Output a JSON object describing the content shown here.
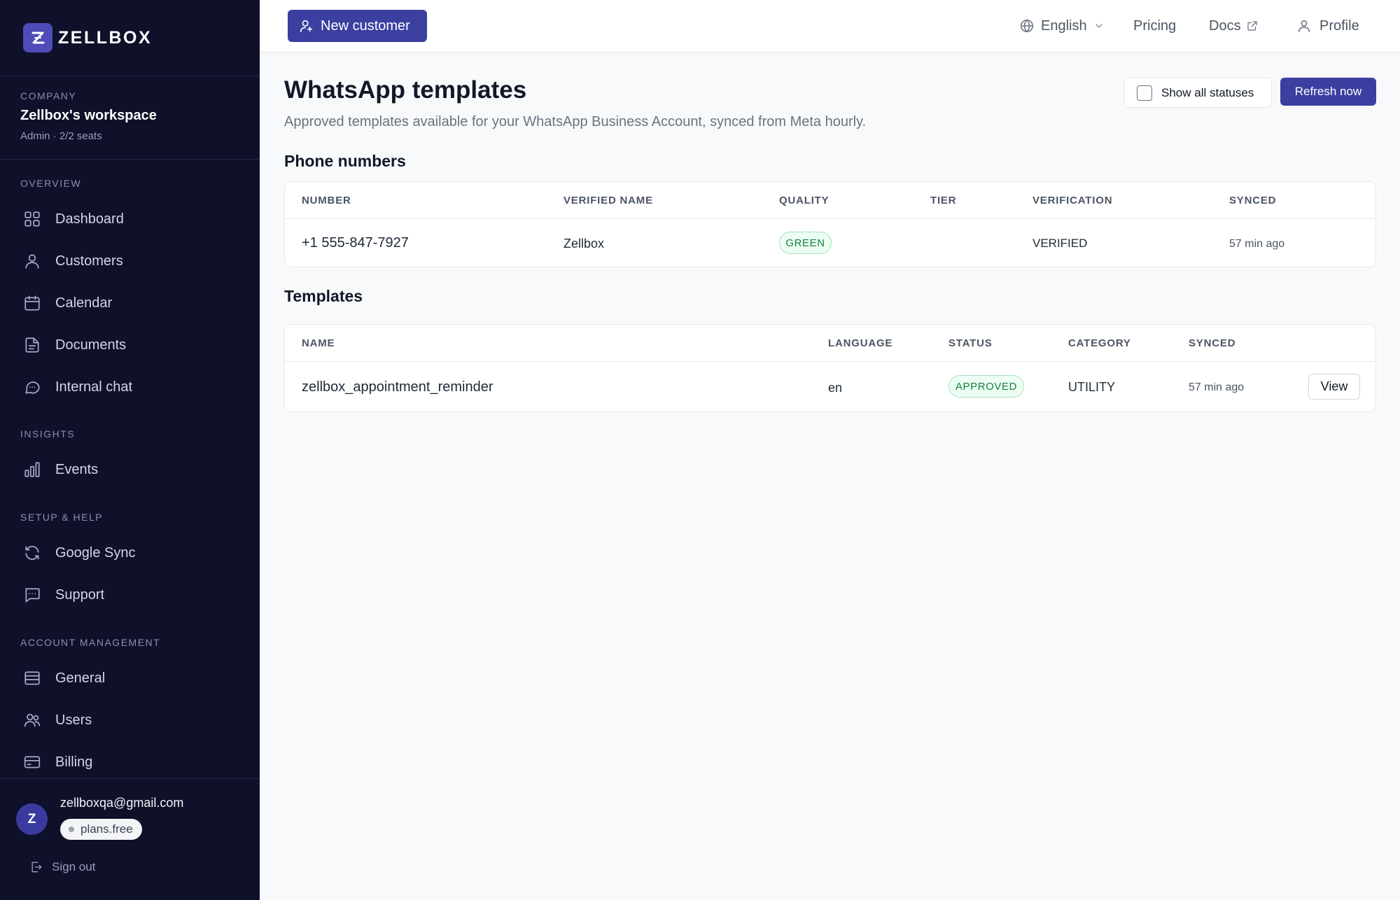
{
  "brand": {
    "name": "ZELLBOX"
  },
  "company": {
    "label": "COMPANY",
    "name": "Zellbox's workspace",
    "meta": "Admin · 2/2 seats"
  },
  "sidebar": {
    "sections": [
      {
        "label": "OVERVIEW"
      },
      {
        "label": "INSIGHTS"
      },
      {
        "label": "SETUP & HELP"
      },
      {
        "label": "ACCOUNT MANAGEMENT"
      }
    ],
    "items": [
      {
        "label": "Dashboard",
        "icon": "grid-icon"
      },
      {
        "label": "Customers",
        "icon": "user-icon"
      },
      {
        "label": "Calendar",
        "icon": "calendar-icon"
      },
      {
        "label": "Documents",
        "icon": "document-icon"
      },
      {
        "label": "Internal chat",
        "icon": "chat-icon"
      },
      {
        "label": "Events",
        "icon": "bar-chart-icon"
      },
      {
        "label": "Google Sync",
        "icon": "refresh-icon"
      },
      {
        "label": "Support",
        "icon": "support-chat-icon"
      },
      {
        "label": "General",
        "icon": "list-icon"
      },
      {
        "label": "Users",
        "icon": "users-icon"
      },
      {
        "label": "Billing",
        "icon": "credit-card-icon"
      }
    ]
  },
  "user": {
    "initial": "Z",
    "email": "zellboxqa@gmail.com",
    "plan": "plans.free",
    "signout": "Sign out"
  },
  "topbar": {
    "new_customer": "New customer",
    "language": "English",
    "pricing": "Pricing",
    "docs": "Docs",
    "profile": "Profile"
  },
  "main": {
    "title": "WhatsApp templates",
    "subtitle": "Approved templates available for your WhatsApp Business Account, synced from Meta hourly.",
    "show_all": "Show all statuses",
    "refresh": "Refresh now",
    "phone_numbers": {
      "title": "Phone numbers",
      "headers": [
        "NUMBER",
        "VERIFIED NAME",
        "QUALITY",
        "TIER",
        "VERIFICATION",
        "SYNCED"
      ],
      "rows": [
        {
          "number": "+1 555-847-7927",
          "verified_name": "Zellbox",
          "quality": "GREEN",
          "tier": "",
          "verification": "VERIFIED",
          "synced": "57 min ago"
        }
      ]
    },
    "templates": {
      "title": "Templates",
      "headers": [
        "NAME",
        "LANGUAGE",
        "STATUS",
        "CATEGORY",
        "SYNCED"
      ],
      "rows": [
        {
          "name": "zellbox_appointment_reminder",
          "language": "en",
          "status": "APPROVED",
          "category": "UTILITY",
          "synced": "57 min ago",
          "action": "View"
        }
      ]
    }
  },
  "colors": {
    "sidebar_bg": "#0f1029",
    "accent": "#3b3fa0",
    "success": "#15803d"
  }
}
